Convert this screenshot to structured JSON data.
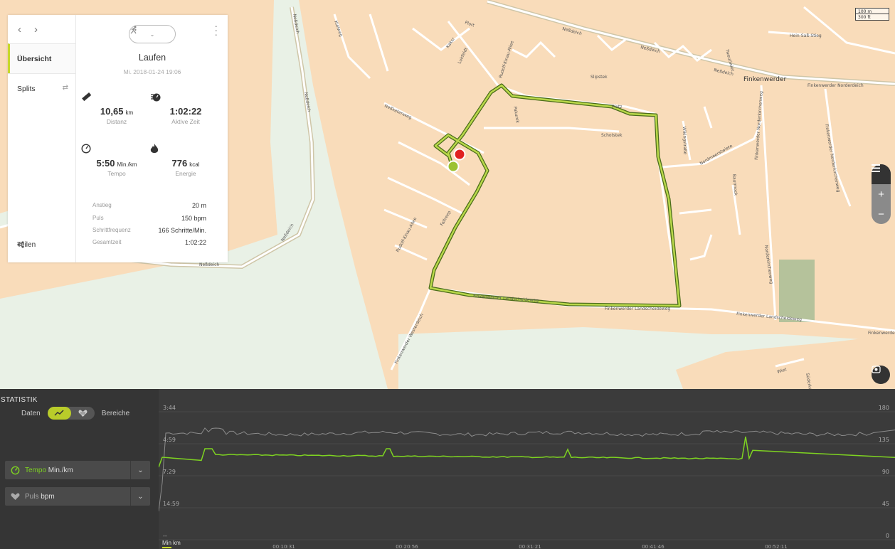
{
  "map": {
    "scale": [
      "100 m",
      "300 ft"
    ],
    "places": {
      "finkenwerder": "Finkenwerder",
      "finkenwerder_norderdeich": "Finkenwerder Norderdeich",
      "finkenwerder_landscheideweg": "Finkenwerder Landscheideweg",
      "finkenwerder_westerdeich": "Finkenwerder Westerdeich",
      "finkenwerder_norderkirchenweg": "Finkenwerder Norderkirchenweg",
      "neßdeich": "Neßdeich",
      "neßkatenweg": "Neßkatenweg",
      "rudolf_kinau_allee": "Rudolf-Kinau-Allee",
      "hein_saß_stieg": "Hein-Saß-Stieg",
      "slipstek": "Slipstek",
      "plotz": "Plotz",
      "schotstek": "Schotstek",
      "wikingstraße": "Wikingstraße",
      "nordmeerstwiete": "Nordmeerstwiete",
      "baurmock": "Baurmock",
      "norderkirchenweg": "Norderkirchenweg",
      "fallreep": "Fallreep",
      "wiet": "Wiet",
      "plort": "Plort",
      "lukfeldt": "Lukfeldt",
      "kaksr": "Kaksr",
      "pakurek": "Pakurek",
      "tweutiwiet": "Tweutiwiet",
      "kielweg": "Kielweg",
      "suderkampweg": "Süderkampweg"
    },
    "controls": {
      "layers": "layers-icon",
      "zoom_in": "+",
      "zoom_out": "−",
      "fit": "fit-route-icon"
    }
  },
  "panel": {
    "sidebar": {
      "items": [
        {
          "label": "Übersicht",
          "active": true
        },
        {
          "label": "Splits",
          "active": false
        }
      ],
      "share_label": "Teilen"
    },
    "sport_icon": "running-icon",
    "title": "Laufen",
    "datetime": "Mi. 2018-01-24 19:06",
    "stats": [
      {
        "icon": "ruler-icon",
        "value": "10,65",
        "unit": "km",
        "label": "Distanz"
      },
      {
        "icon": "stopwatch-icon",
        "value": "1:02:22",
        "unit": "",
        "label": "Aktive Zeit"
      },
      {
        "icon": "speedometer-icon",
        "value": "5:50",
        "unit": "Min./km",
        "label": "Tempo"
      },
      {
        "icon": "flame-icon",
        "value": "776",
        "unit": "kcal",
        "label": "Energie"
      }
    ],
    "details": [
      {
        "key": "Anstieg",
        "value": "20 m"
      },
      {
        "key": "Puls",
        "value": "150 bpm"
      },
      {
        "key": "Schrittfrequenz",
        "value": "166 Schritte/Min."
      },
      {
        "key": "Gesamtzeit",
        "value": "1:02:22"
      }
    ]
  },
  "statistics": {
    "title": "STATISTIK",
    "toggle_left": "Daten",
    "toggle_right": "Bereiche",
    "metrics": [
      {
        "name": "Tempo",
        "unit": "Min./km",
        "color": "#7ed321"
      },
      {
        "name": "Puls",
        "unit": "bpm",
        "color": "#cccccc"
      }
    ],
    "unit_tabs": [
      "Min",
      "km"
    ],
    "axis_left": [
      "3:44",
      "4:59",
      "7:29",
      "14:59",
      "--"
    ],
    "axis_right": [
      "180",
      "135",
      "90",
      "45",
      "0"
    ],
    "axis_time": [
      "00:10:31",
      "00:20:56",
      "00:31:21",
      "00:41:46",
      "00:52:11"
    ]
  },
  "chart_data": {
    "type": "line",
    "x_label": "time",
    "x": [
      "00:10:31",
      "00:20:56",
      "00:31:21",
      "00:41:46",
      "00:52:11"
    ],
    "series": [
      {
        "name": "Tempo",
        "unit": "Min./km",
        "values": [
          6.0,
          5.9,
          5.95,
          5.9,
          5.6
        ],
        "color": "#7ed321"
      },
      {
        "name": "Puls",
        "unit": "bpm",
        "values": [
          148,
          150,
          151,
          150,
          152
        ],
        "color": "#9a9a9a"
      }
    ],
    "ylim_left": [
      "3:44",
      "14:59"
    ],
    "ylim_right": [
      0,
      180
    ],
    "grid": true
  }
}
